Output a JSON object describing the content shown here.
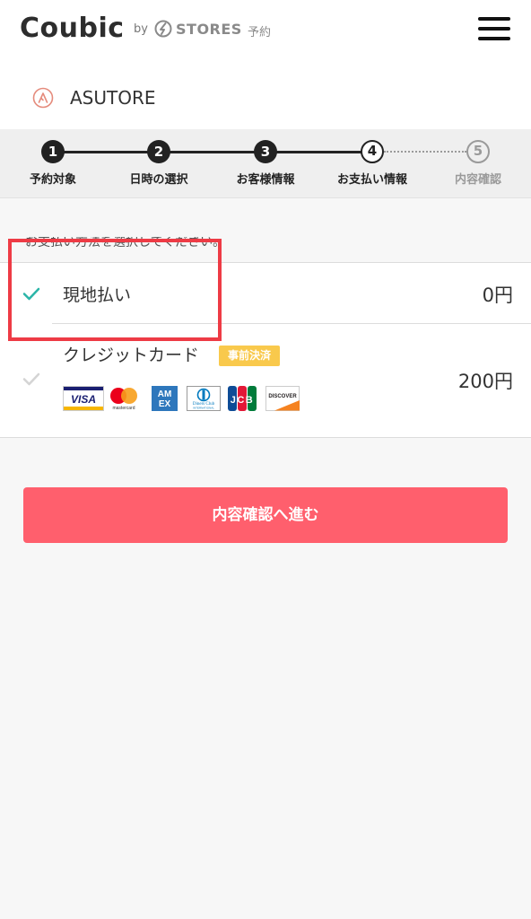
{
  "header": {
    "logo": "Coubic",
    "by": "by",
    "stores": "STORES",
    "yoyaku": "予約",
    "icons": {
      "menu": "hamburger-menu-icon",
      "stores": "stores-mark-icon"
    }
  },
  "shop": {
    "name": "ASUTORE",
    "icon": "shop-logo-icon"
  },
  "steps": [
    {
      "num": "1",
      "label": "予約対象",
      "state": "done"
    },
    {
      "num": "2",
      "label": "日時の選択",
      "state": "done"
    },
    {
      "num": "3",
      "label": "お客様情報",
      "state": "done"
    },
    {
      "num": "4",
      "label": "お支払い情報",
      "state": "current"
    },
    {
      "num": "5",
      "label": "内容確認",
      "state": "upcoming"
    }
  ],
  "instruction": "お支払い方法を選択してください。",
  "payment": {
    "options": [
      {
        "label": "現地払い",
        "price": "0円",
        "selected": true
      },
      {
        "label": "クレジットカード",
        "badge": "事前決済",
        "price": "200円",
        "selected": false
      }
    ],
    "cards": {
      "visa": "VISA",
      "mastercard": "mastercard",
      "amex_top": "AM",
      "amex_bottom": "EX",
      "diners": "Diners Club",
      "diners_sub": "INTERNATIONAL",
      "jcb": "JCB",
      "discover": "DISCOVER"
    }
  },
  "proceed_button": "内容確認へ進む",
  "colors": {
    "accent": "#ff5f6d",
    "check": "#2bb5a8",
    "badge": "#f9c94c",
    "highlight": "#ee3b45"
  }
}
